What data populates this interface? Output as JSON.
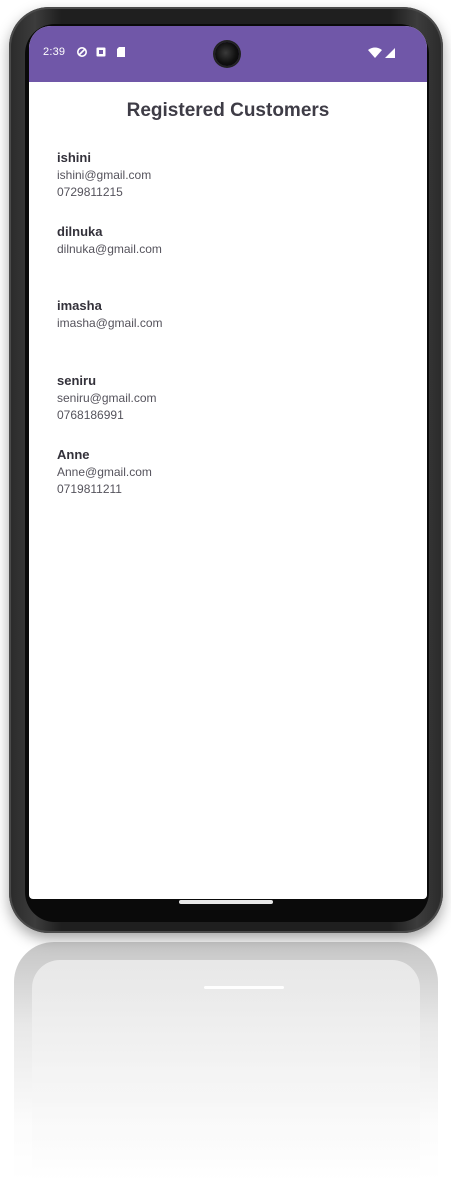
{
  "status_bar": {
    "time": "2:39",
    "left_icons": [
      "shield-icon",
      "notification-icon",
      "sd-card-icon"
    ],
    "right_icons": [
      "wifi-icon",
      "cell-signal-icon"
    ],
    "color": "#7057a8"
  },
  "page": {
    "title": "Registered Customers"
  },
  "customers": [
    {
      "name": "ishini",
      "email": "ishini@gmail.com",
      "phone": "0729811215"
    },
    {
      "name": "dilnuka",
      "email": "dilnuka@gmail.com",
      "phone": ""
    },
    {
      "name": "imasha",
      "email": "imasha@gmail.com",
      "phone": ""
    },
    {
      "name": "seniru",
      "email": "seniru@gmail.com",
      "phone": "0768186991"
    },
    {
      "name": "Anne",
      "email": "Anne@gmail.com",
      "phone": "0719811211"
    }
  ]
}
